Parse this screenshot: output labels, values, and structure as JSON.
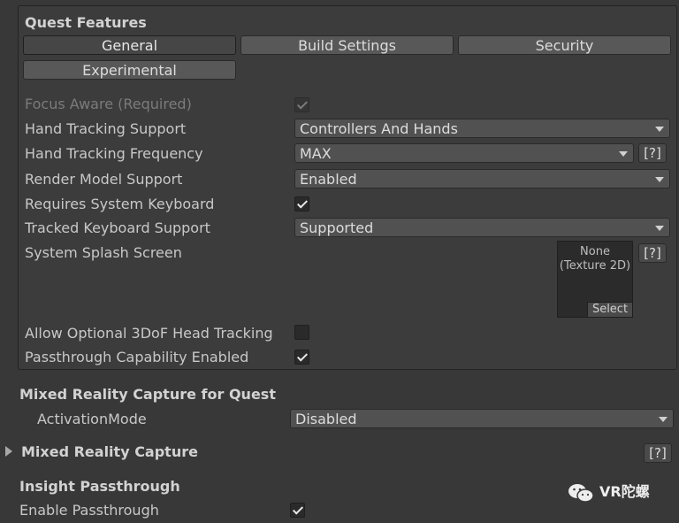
{
  "quest_features": {
    "title": "Quest Features",
    "tabs": [
      "General",
      "Build Settings",
      "Security",
      "Experimental"
    ],
    "active_tab": "General",
    "fields": {
      "focus_aware": {
        "label": "Focus Aware (Required)",
        "checked": true,
        "disabled": true
      },
      "hand_tracking_support": {
        "label": "Hand Tracking Support",
        "value": "Controllers And Hands"
      },
      "hand_tracking_frequency": {
        "label": "Hand Tracking Frequency",
        "value": "MAX",
        "help": "[?]"
      },
      "render_model_support": {
        "label": "Render Model Support",
        "value": "Enabled"
      },
      "requires_system_keyboard": {
        "label": "Requires System Keyboard",
        "checked": true
      },
      "tracked_keyboard_support": {
        "label": "Tracked Keyboard Support",
        "value": "Supported"
      },
      "system_splash_screen": {
        "label": "System Splash Screen",
        "value_line1": "None",
        "value_line2": "(Texture 2D)",
        "select": "Select",
        "help": "[?]"
      },
      "allow_optional_3dof": {
        "label": "Allow Optional 3DoF Head Tracking",
        "checked": false
      },
      "passthrough_capability": {
        "label": "Passthrough Capability Enabled",
        "checked": true
      }
    }
  },
  "mixed_reality_capture_quest": {
    "title": "Mixed Reality Capture for Quest",
    "activation_mode": {
      "label": "ActivationMode",
      "value": "Disabled"
    }
  },
  "mixed_reality_capture": {
    "title": "Mixed Reality Capture",
    "help": "[?]"
  },
  "insight_passthrough": {
    "title": "Insight Passthrough",
    "enable_passthrough": {
      "label": "Enable Passthrough",
      "checked": true
    }
  },
  "watermark": {
    "text": "VR陀螺"
  }
}
